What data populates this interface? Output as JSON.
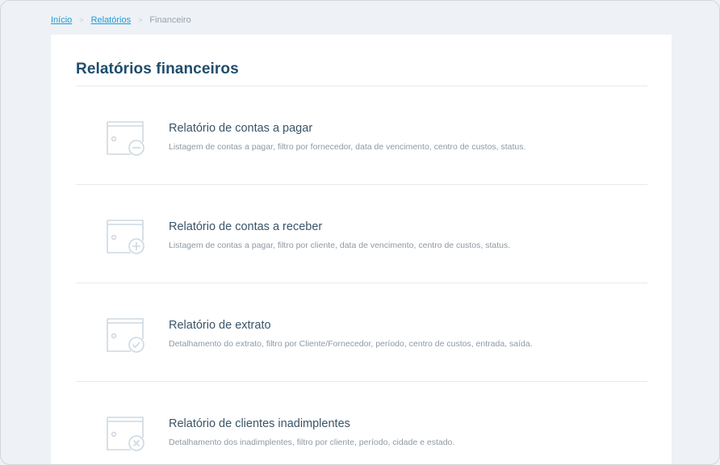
{
  "breadcrumb": {
    "home": "Início",
    "reports": "Relatórios",
    "current": "Financeiro",
    "separator": ">"
  },
  "page": {
    "title": "Relatórios financeiros"
  },
  "reports": [
    {
      "name": "Relatório de contas a pagar",
      "description": "Listagem de contas a pagar, filtro por fornecedor, data de vencimento, centro de custos, status.",
      "icon": "wallet-minus-icon"
    },
    {
      "name": "Relatório de contas a receber",
      "description": "Listagem de contas a pagar, filtro por cliente, data de vencimento, centro de custos, status.",
      "icon": "wallet-plus-icon"
    },
    {
      "name": "Relatório de extrato",
      "description": "Detalhamento do extrato, filtro por Cliente/Fornecedor, período, centro de custos, entrada, saída.",
      "icon": "wallet-check-icon"
    },
    {
      "name": "Relatório de clientes inadimplentes",
      "description": "Detalhamento dos inadimplentes, filtro por cliente, período, cidade e estado.",
      "icon": "wallet-x-icon"
    }
  ],
  "colors": {
    "link": "#1f9ad6",
    "title": "#1e4d6b",
    "icon_stroke": "#cdd8e0"
  }
}
